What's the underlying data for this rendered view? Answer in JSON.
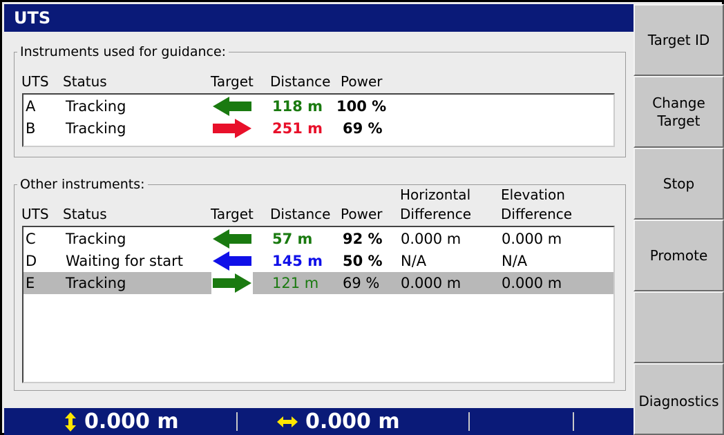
{
  "window": {
    "title": "UTS"
  },
  "colors": {
    "title_bg": "#0a1a78",
    "green": "#1a7a10",
    "red": "#e8102a",
    "blue": "#1010e8"
  },
  "guidance": {
    "legend": "Instruments used for guidance:",
    "headers": {
      "uts": "UTS",
      "status": "Status",
      "target": "Target",
      "distance": "Distance",
      "power": "Power"
    },
    "rows": [
      {
        "uts": "A",
        "status": "Tracking",
        "target_icon": "arrow-left-green",
        "distance": "118 m",
        "power": "100 %"
      },
      {
        "uts": "B",
        "status": "Tracking",
        "target_icon": "arrow-right-red",
        "distance": "251 m",
        "power": "69 %"
      }
    ]
  },
  "other": {
    "legend": "Other instruments:",
    "headers": {
      "uts": "UTS",
      "status": "Status",
      "target": "Target",
      "distance": "Distance",
      "power": "Power",
      "hdiff_line1": "Horizontal",
      "hdiff_line2": "Difference",
      "ediff_line1": "Elevation",
      "ediff_line2": "Difference"
    },
    "rows": [
      {
        "uts": "C",
        "status": "Tracking",
        "target_icon": "arrow-left-green",
        "distance": "57 m",
        "power": "92 %",
        "hdiff": "0.000 m",
        "ediff": "0.000 m"
      },
      {
        "uts": "D",
        "status": "Waiting for start",
        "target_icon": "arrow-left-blue",
        "distance": "145 m",
        "power": "50 %",
        "hdiff": "N/A",
        "ediff": "N/A"
      },
      {
        "uts": "E",
        "status": "Tracking",
        "target_icon": "arrow-right-green",
        "distance": "121 m",
        "power": "69 %",
        "hdiff": "0.000 m",
        "ediff": "0.000 m",
        "selected": true
      }
    ]
  },
  "sidebar": {
    "buttons": [
      {
        "label_line1": "Target ID",
        "label_line2": ""
      },
      {
        "label_line1": "Change",
        "label_line2": "Target"
      },
      {
        "label_line1": "Stop",
        "label_line2": ""
      },
      {
        "label_line1": "Promote",
        "label_line2": ""
      },
      {
        "label_line1": "",
        "label_line2": ""
      },
      {
        "label_line1": "Diagnostics",
        "label_line2": ""
      }
    ]
  },
  "statusbar": {
    "vertical_icon": "vertical-arrows-icon",
    "vertical_value": "0.000 m",
    "horizontal_icon": "horizontal-arrows-icon",
    "horizontal_value": "0.000 m"
  }
}
